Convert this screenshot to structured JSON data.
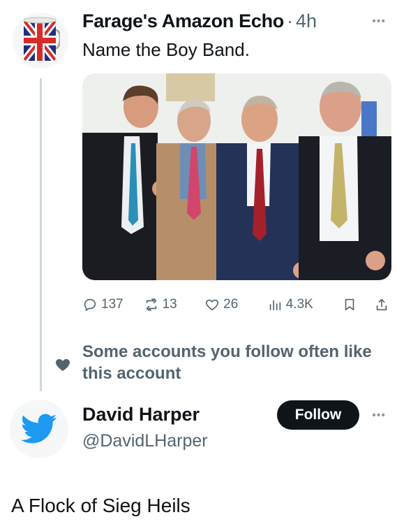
{
  "tweet": {
    "author_name": "Farage's Amazon Echo",
    "separator": "·",
    "time": "4h",
    "text": "Name the Boy Band.",
    "photo_icon": "group-photo",
    "stats": {
      "replies": "137",
      "retweets": "13",
      "likes": "26",
      "views": "4.3K"
    }
  },
  "social_context": {
    "icon": "heart-icon",
    "text": "Some accounts you follow often like this account"
  },
  "suggestion": {
    "name": "David Harper",
    "handle": "@DavidLHarper",
    "follow_label": "Follow",
    "avatar_icon": "twitter-bird-icon"
  },
  "caption": "A Flock of Sieg Heils",
  "colors": {
    "text": "#0f1419",
    "secondary": "#536471",
    "thread_line": "#cfd9de",
    "twitter_blue": "#1d9bf0",
    "button": "#0f1419"
  }
}
